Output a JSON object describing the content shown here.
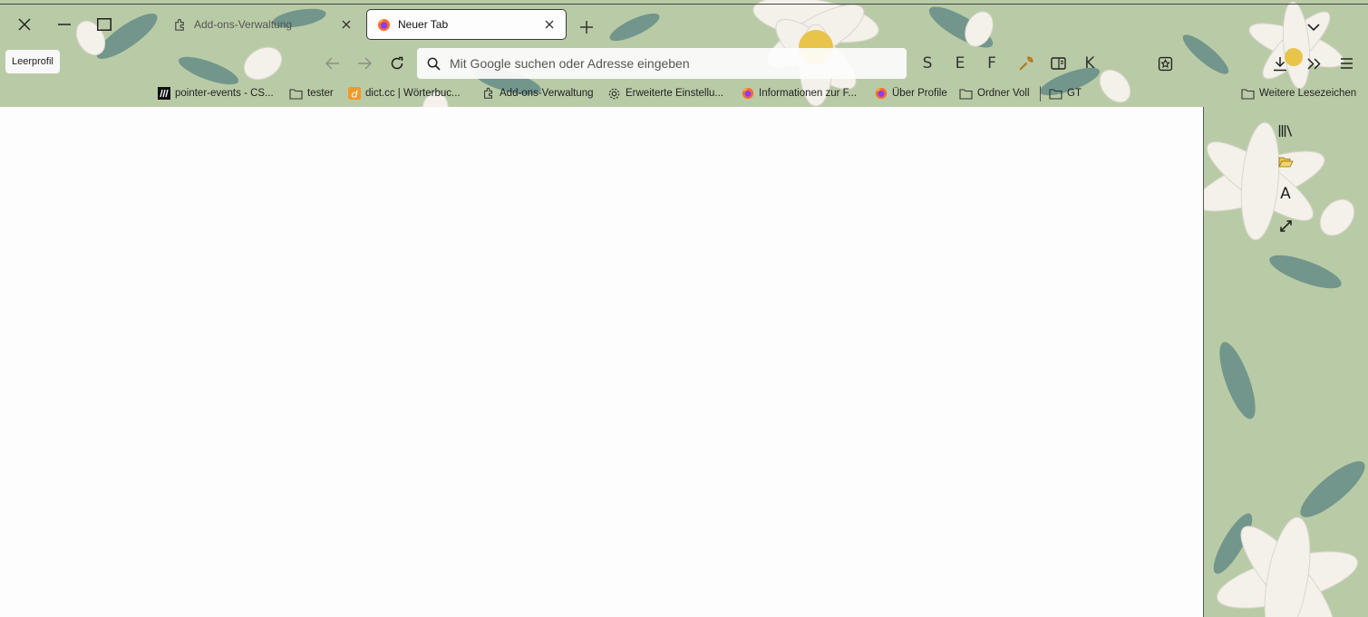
{
  "window": {
    "close_label": "Close window",
    "minimize_label": "Minimize",
    "maximize_label": "Maximize"
  },
  "tabs": [
    {
      "label": "Add-ons-Verwaltung",
      "icon": "puzzle-icon",
      "active": false
    },
    {
      "label": "Neuer Tab",
      "icon": "firefox-icon",
      "active": true
    }
  ],
  "profile": {
    "label": "Leerprofil"
  },
  "navbar": {
    "url_placeholder": "Mit Google suchen oder Adresse eingeben",
    "toolbar_letters": [
      "S",
      "E",
      "F"
    ],
    "letter_k": "K"
  },
  "bookmarks": [
    {
      "label": "pointer-events - CS...",
      "icon": "mdn-icon"
    },
    {
      "label": "tester",
      "icon": "folder-icon"
    },
    {
      "label": "dict.cc | Wörterbuc...",
      "icon": "dictcc-icon"
    },
    {
      "label": "Add-ons-Verwaltung",
      "icon": "puzzle-icon"
    },
    {
      "label": "Erweiterte Einstellu...",
      "icon": "gear-icon"
    },
    {
      "label": "Informationen zur F...",
      "icon": "firefox-icon"
    },
    {
      "label": "Über Profile",
      "icon": "firefox-icon"
    },
    {
      "label": "Ordner Voll",
      "icon": "folder-icon"
    },
    {
      "label": "GT",
      "icon": "folder-icon"
    },
    {
      "label": "Weitere Lesezeichen",
      "icon": "folder-icon"
    }
  ],
  "sidebar_tools": {
    "library": "library-icon",
    "open_folder": "open-folder-icon",
    "font_letter": "A",
    "fullscreen": "expand-arrows-icon"
  },
  "colors": {
    "theme_green": "#b9cba6",
    "leaf_dark": "#4f7b7a",
    "petal": "#f3f1ea",
    "flower_center": "#e8c44a",
    "content_bg": "#fdfdfd"
  }
}
